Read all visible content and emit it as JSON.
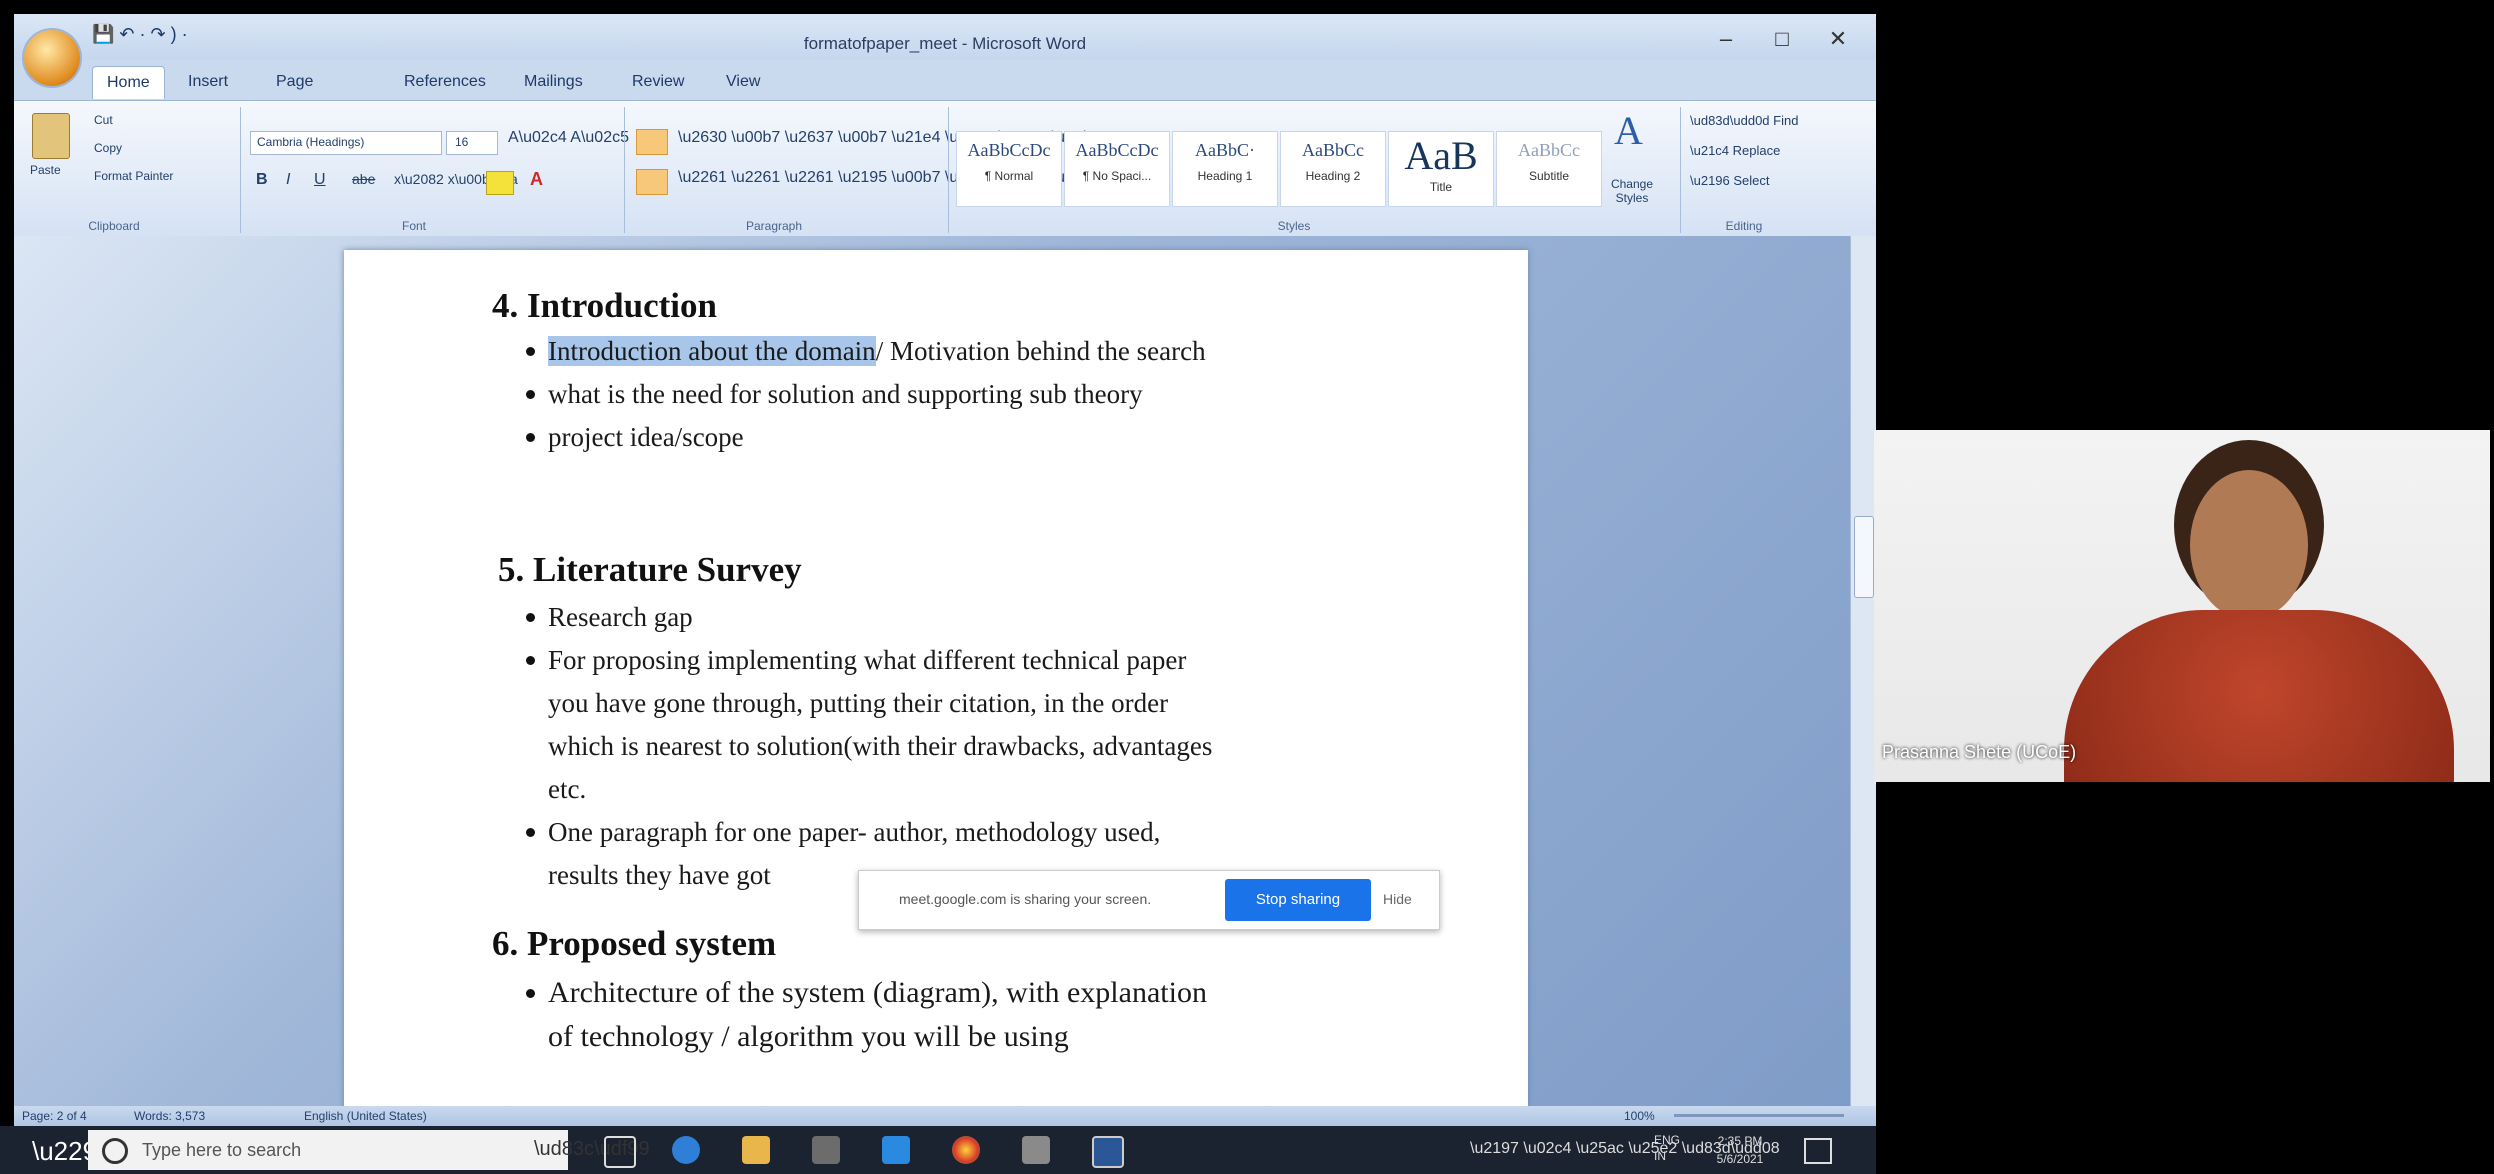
{
  "window": {
    "title": "formatofpaper_meet - Microsoft Word",
    "quick_access": "💾 ↶ · ↷ ) ·",
    "controls": [
      "–",
      "□",
      "✕"
    ]
  },
  "ribbon": {
    "tabs": [
      "Home",
      "Insert",
      "Page Layout",
      "References",
      "Mailings",
      "Review",
      "View"
    ],
    "clipboard": {
      "paste": "Paste",
      "cut": "Cut",
      "copy": "Copy",
      "format_painter": "Format Painter",
      "label": "Clipboard"
    },
    "font": {
      "name": "Cambria (Headings)",
      "size": "16",
      "label": "Font"
    },
    "paragraph": {
      "label": "Paragraph"
    },
    "styles": {
      "items": [
        {
          "sample": "AaBbCcDc",
          "name": "¶ Normal"
        },
        {
          "sample": "AaBbCcDc",
          "name": "¶ No Spaci..."
        },
        {
          "sample": "AaBbC·",
          "name": "Heading 1"
        },
        {
          "sample": "AaBbCc",
          "name": "Heading 2"
        },
        {
          "sample": "AaB",
          "name": "Title"
        },
        {
          "sample": "AaBbCc",
          "name": "Subtitle"
        }
      ],
      "change_styles": "Change Styles",
      "label": "Styles"
    },
    "editing": {
      "find": "Find",
      "replace": "Replace",
      "select": "Select",
      "label": "Editing"
    }
  },
  "document": {
    "sections": [
      {
        "heading": "4. Introduction",
        "items": [
          {
            "highlight": "Introduction about the domain",
            "text": "/ Motivation behind the search"
          },
          {
            "text": "what is the need for solution and supporting sub theory"
          },
          {
            "text": "project idea/scope"
          }
        ]
      },
      {
        "heading": "5. Literature Survey",
        "items": [
          {
            "text": "Research gap"
          },
          {
            "lines": [
              "For proposing implementing what different technical paper",
              "you have gone through, putting their citation, in the order",
              "which is nearest to solution(with their drawbacks, advantages",
              "etc."
            ]
          },
          {
            "lines": [
              "One paragraph for one paper- author, methodology used,",
              "results they have got"
            ]
          }
        ]
      },
      {
        "heading": "6. Proposed system",
        "items": [
          {
            "lines": [
              "Architecture of the system (diagram), with explanation",
              "of  technology / algorithm you will be using"
            ]
          }
        ]
      }
    ]
  },
  "status_bar": {
    "page": "Page: 2 of 4",
    "words": "Words: 3,573",
    "language": "English (United States)",
    "zoom": "100%"
  },
  "share_banner": {
    "text": "meet.google.com is sharing your screen.",
    "stop": "Stop sharing",
    "hide": "Hide"
  },
  "taskbar": {
    "search_placeholder": "Type here to search",
    "time": "2:35 PM",
    "date": "5/6/2021",
    "lang": "ENG IN"
  },
  "webcam": {
    "name": "Prasanna Shete (UCoE)"
  }
}
